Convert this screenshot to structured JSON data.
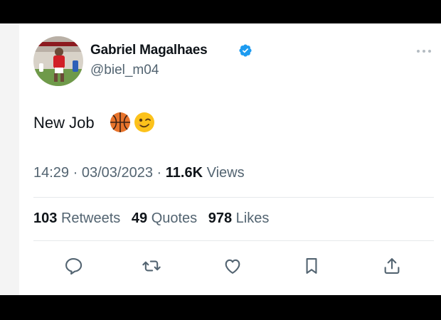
{
  "tweet": {
    "author": {
      "display_name": "Gabriel Magalhaes",
      "handle": "@biel_m04",
      "verified": true
    },
    "text": "New Job",
    "emojis": [
      "basketball-emoji",
      "winking-face-emoji"
    ],
    "time": "14:29",
    "separator": "·",
    "date": "03/03/2023",
    "views_count": "11.6K",
    "views_label": "Views",
    "stats": {
      "retweets_count": "103",
      "retweets_label": "Retweets",
      "quotes_count": "49",
      "quotes_label": "Quotes",
      "likes_count": "978",
      "likes_label": "Likes"
    },
    "actions": [
      "reply-icon",
      "retweet-icon",
      "like-icon",
      "bookmark-icon",
      "share-icon"
    ]
  },
  "colors": {
    "background": "#000000",
    "card": "#ffffff",
    "text_primary": "#0f1419",
    "text_secondary": "#536471",
    "verified_badge": "#1d9bf0",
    "divider": "#e6e9eb"
  }
}
